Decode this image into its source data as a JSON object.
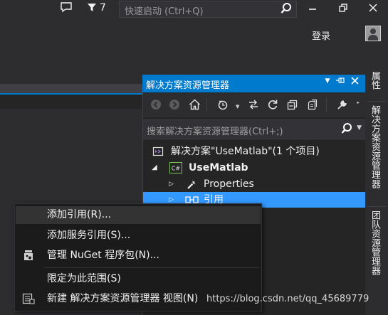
{
  "titlebar": {
    "notification_icon": "speech-bubble-icon",
    "feedback_icon": "funnel-icon",
    "feedback_count": "7",
    "quick_launch_placeholder": "快速启动 (Ctrl+Q)",
    "login_label": "登录"
  },
  "solution_explorer": {
    "title": "解决方案资源管理器",
    "search_placeholder": "搜索解决方案资源管理器(Ctrl+;)",
    "tree": [
      {
        "label": "解决方案\"UseMatlab\"(1 个项目)",
        "icon": "solution-icon"
      },
      {
        "label": "UseMatlab",
        "icon": "csharp-project-icon",
        "bold": true,
        "expanded": true
      },
      {
        "label": "Properties",
        "icon": "wrench-icon"
      },
      {
        "label": "引用",
        "icon": "references-icon",
        "selected": true
      }
    ]
  },
  "dock_tabs": [
    "属性",
    "解决方案资源管理器",
    "团队资源管理器"
  ],
  "context_menu": {
    "items": [
      {
        "label": "添加引用(R)...",
        "highlighted": true
      },
      {
        "label": "添加服务引用(S)..."
      },
      {
        "label": "管理 NuGet 程序包(N)...",
        "icon": "nuget-icon"
      },
      {
        "label": "限定为此范围(S)"
      },
      {
        "label": "新建 解决方案资源管理器 视图(N)",
        "icon": "new-view-icon"
      }
    ]
  },
  "watermark": "https://blog.csdn.net/qq_45689779",
  "colors": {
    "accent": "#007acc",
    "selection": "#3399ff",
    "background": "#2d2d30"
  }
}
